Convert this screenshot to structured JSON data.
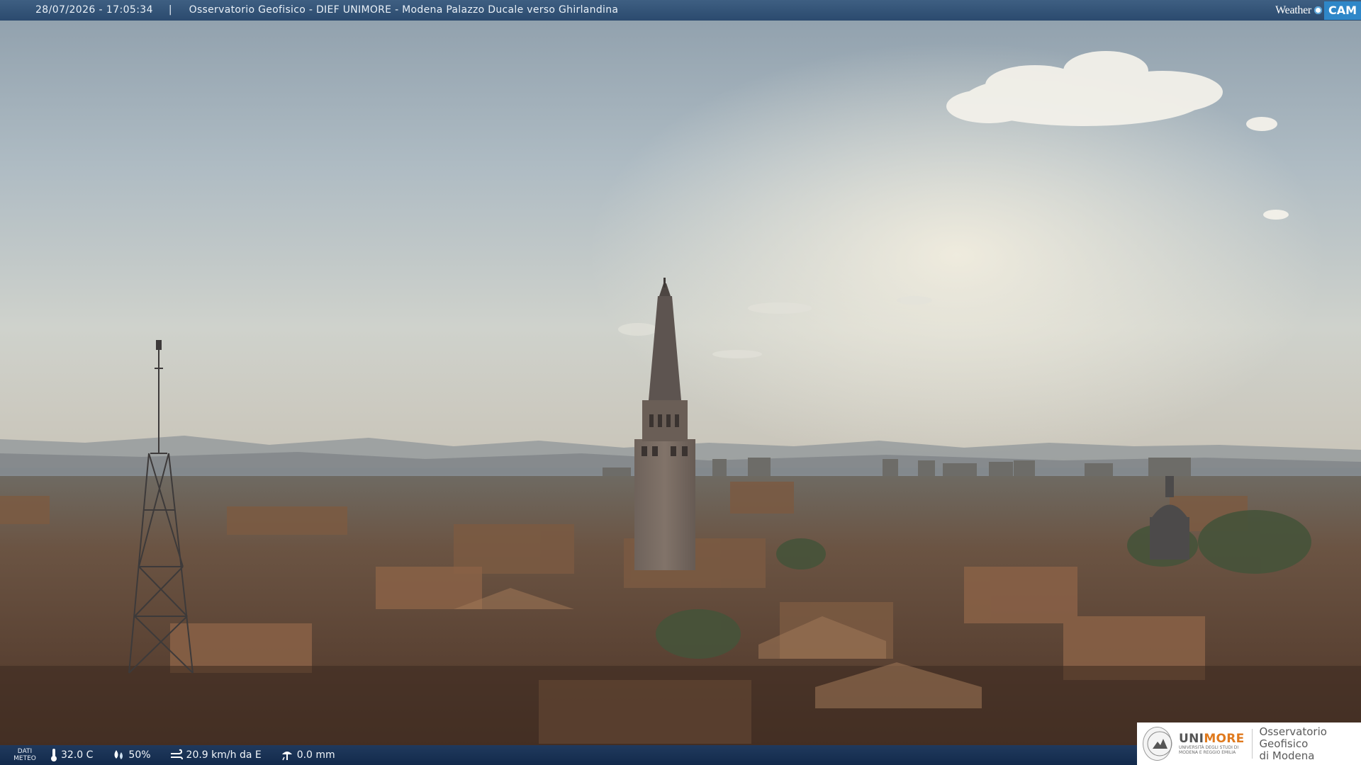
{
  "header": {
    "timestamp": "28/07/2026 - 17:05:34",
    "separator": "|",
    "title": "Osservatorio Geofisico - DIEF UNIMORE - Modena Palazzo Ducale verso Ghirlandina"
  },
  "brand": {
    "word": "Weather",
    "cam": "CAM",
    "accent": "#2f87c8"
  },
  "footer": {
    "dati_label_1": "DATI",
    "dati_label_2": "METEO",
    "temperature": "32.0 C",
    "humidity": "50%",
    "wind": "20.9 km/h da E",
    "rain": "0.0 mm"
  },
  "logo": {
    "uni": "UNI",
    "more": "MORE",
    "uni_subtitle": "UNIVERSITÀ DEGLI STUDI DI MODENA E REGGIO EMILIA",
    "observatory_line1": "Osservatorio Geofisico",
    "observatory_line2": "di Modena",
    "accent": "#e07a1e"
  },
  "icons": {
    "temperature": "thermometer-icon",
    "humidity": "droplets-icon",
    "wind": "wind-icon",
    "rain": "rain-gauge-icon"
  }
}
